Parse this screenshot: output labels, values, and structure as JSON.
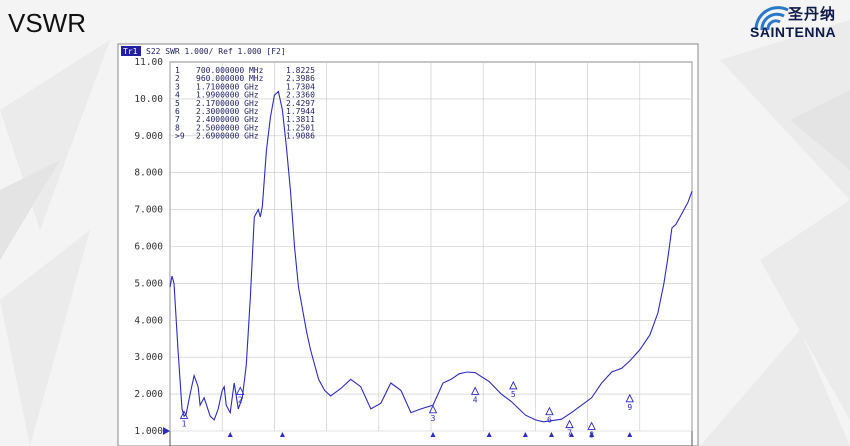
{
  "slide": {
    "title": "VSWR"
  },
  "logo": {
    "cn": "圣丹纳",
    "en": "SAINTENNA",
    "brand_color": "#0d1a4a",
    "arc_color": "#2a78c8"
  },
  "instrument": {
    "trace_tag": "Tr1",
    "header": "S22  SWR 1.000/ Ref 1.000  [F2]"
  },
  "chart_data": {
    "type": "line",
    "title": "",
    "xlabel": "",
    "ylabel": "",
    "xlim": [
      0.4,
      3.0
    ],
    "ylim": [
      1.0,
      11.0
    ],
    "x_unit": "GHz",
    "grid": true,
    "y_ticks": [
      "1.000",
      "2.000",
      "3.000",
      "4.000",
      "5.000",
      "6.000",
      "7.000",
      "8.000",
      "9.000",
      "10.00",
      "11.00"
    ],
    "trace_color": "#2c2cc0",
    "series": [
      {
        "x": [
          0.4,
          0.41,
          0.42,
          0.44,
          0.46,
          0.47,
          0.48,
          0.5,
          0.52,
          0.54,
          0.55,
          0.57,
          0.6,
          0.62,
          0.64,
          0.66,
          0.67,
          0.68,
          0.7,
          0.72,
          0.74,
          0.76,
          0.78,
          0.8,
          0.82,
          0.84,
          0.85,
          0.86,
          0.88,
          0.9,
          0.92,
          0.94,
          0.96,
          0.98,
          1.0,
          1.02,
          1.04,
          1.06,
          1.08,
          1.1,
          1.12,
          1.14,
          1.17,
          1.2,
          1.25,
          1.3,
          1.35,
          1.4,
          1.45,
          1.5,
          1.55,
          1.6,
          1.65,
          1.71,
          1.76,
          1.8,
          1.84,
          1.88,
          1.92,
          1.99,
          2.05,
          2.1,
          2.17,
          2.22,
          2.26,
          2.3,
          2.35,
          2.4,
          2.45,
          2.5,
          2.55,
          2.6,
          2.65,
          2.69,
          2.74,
          2.79,
          2.83,
          2.86,
          2.88,
          2.9,
          2.92,
          2.94,
          2.96,
          2.98,
          3.0
        ],
        "y": [
          4.9,
          5.2,
          5.0,
          3.2,
          1.6,
          1.4,
          1.45,
          2.0,
          2.5,
          2.2,
          1.7,
          1.9,
          1.4,
          1.3,
          1.6,
          2.1,
          2.2,
          1.7,
          1.5,
          2.3,
          1.6,
          1.9,
          2.8,
          4.6,
          6.8,
          7.0,
          6.8,
          7.1,
          8.6,
          9.5,
          10.1,
          10.2,
          9.7,
          8.7,
          7.5,
          6.0,
          4.9,
          4.3,
          3.7,
          3.2,
          2.8,
          2.4,
          2.1,
          1.95,
          2.15,
          2.4,
          2.2,
          1.6,
          1.75,
          2.3,
          2.1,
          1.5,
          1.6,
          1.7,
          2.3,
          2.4,
          2.55,
          2.6,
          2.58,
          2.34,
          2.0,
          1.8,
          1.43,
          1.3,
          1.25,
          1.28,
          1.32,
          1.5,
          1.7,
          1.9,
          2.3,
          2.6,
          2.7,
          2.9,
          3.2,
          3.6,
          4.2,
          5.0,
          5.7,
          6.5,
          6.6,
          6.8,
          7.0,
          7.2,
          7.5
        ]
      }
    ],
    "markers": [
      {
        "id": "1",
        "x": 0.7,
        "x_label": "700.000000 MHz",
        "value": "1.8225",
        "y": 1.8225
      },
      {
        "id": "2",
        "x": 0.96,
        "x_label": "960.000000 MHz",
        "value": "2.3986",
        "y": 2.3986
      },
      {
        "id": "3",
        "x": 1.71,
        "x_label": "1.7100000 GHz",
        "value": "1.7304",
        "y": 1.7304
      },
      {
        "id": "4",
        "x": 1.99,
        "x_label": "1.9900000 GHz",
        "value": "2.3360",
        "y": 2.336
      },
      {
        "id": "5",
        "x": 2.17,
        "x_label": "2.1700000 GHz",
        "value": "2.4297",
        "y": 2.4297
      },
      {
        "id": "6",
        "x": 2.3,
        "x_label": "2.3000000 GHz",
        "value": "1.7944",
        "y": 1.7944
      },
      {
        "id": "7",
        "x": 2.4,
        "x_label": "2.4000000 GHz",
        "value": "1.3811",
        "y": 1.3811
      },
      {
        "id": "8",
        "x": 2.5,
        "x_label": "2.5000000 GHz",
        "value": "1.2501",
        "y": 1.2501
      },
      {
        "id": "9",
        "x": 2.69,
        "x_label": "2.6900000 GHz",
        "value": "1.9086",
        "y": 1.9086,
        "active": true
      }
    ],
    "marker_label_positions": [
      {
        "id": "1",
        "x": 0.47,
        "y": 1.45
      },
      {
        "id": "2",
        "x": 0.75,
        "y": 2.1
      },
      {
        "id": "3",
        "x": 1.71,
        "y": 1.6
      },
      {
        "id": "4",
        "x": 1.92,
        "y": 2.1
      },
      {
        "id": "5",
        "x": 2.11,
        "y": 2.25
      },
      {
        "id": "6",
        "x": 2.29,
        "y": 1.55
      },
      {
        "id": "7",
        "x": 2.39,
        "y": 1.2
      },
      {
        "id": "8",
        "x": 2.5,
        "y": 1.15
      },
      {
        "id": "9",
        "x": 2.69,
        "y": 1.9
      }
    ]
  }
}
